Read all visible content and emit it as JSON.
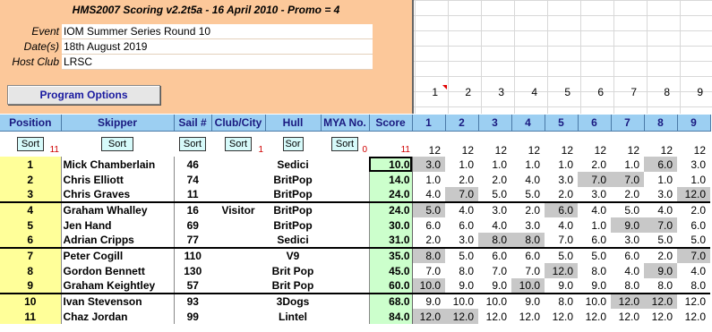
{
  "app_title": "HMS2007 Scoring v2.2t5a - 16 April 2010 - Promo = 4",
  "event_info": [
    {
      "label": "Event",
      "value": "IOM Summer Series Round 10"
    },
    {
      "label": "Date(s)",
      "value": "18th August 2019"
    },
    {
      "label": "Host Club",
      "value": "LRSC"
    }
  ],
  "program_options_label": "Program Options",
  "race_numbers_top": [
    "1",
    "2",
    "3",
    "4",
    "5",
    "6",
    "7",
    "8",
    "9"
  ],
  "columns": {
    "position": "Position",
    "skipper": "Skipper",
    "sail": "Sail #",
    "club": "Club/City",
    "hull": "Hull",
    "mya": "MYA No.",
    "score": "Score",
    "races": [
      "1",
      "2",
      "3",
      "4",
      "5",
      "6",
      "7",
      "8",
      "9"
    ]
  },
  "sort_row": {
    "sort_label": "Sort",
    "sor_label": "Sor",
    "position_count": "11",
    "club_count": "1",
    "mya_count": "0",
    "score_count": "11",
    "race_counts": [
      "12",
      "12",
      "12",
      "12",
      "12",
      "12",
      "12",
      "12",
      "12"
    ]
  },
  "rows": [
    {
      "pos": "1",
      "skipper": "Mick Chamberlain",
      "sail": "46",
      "club": "",
      "hull": "Sedici",
      "mya": "",
      "score": "10.0",
      "races": [
        "3.0",
        "1.0",
        "1.0",
        "1.0",
        "1.0",
        "2.0",
        "1.0",
        "6.0",
        "3.0"
      ],
      "disc": [
        0,
        7
      ]
    },
    {
      "pos": "2",
      "skipper": "Chris Elliott",
      "sail": "74",
      "club": "",
      "hull": "BritPop",
      "mya": "",
      "score": "14.0",
      "races": [
        "1.0",
        "2.0",
        "2.0",
        "4.0",
        "3.0",
        "7.0",
        "7.0",
        "1.0",
        "1.0"
      ],
      "disc": [
        5,
        6
      ]
    },
    {
      "pos": "3",
      "skipper": "Chris Graves",
      "sail": "11",
      "club": "",
      "hull": "BritPop",
      "mya": "",
      "score": "24.0",
      "races": [
        "4.0",
        "7.0",
        "5.0",
        "5.0",
        "2.0",
        "3.0",
        "2.0",
        "3.0",
        "12.0"
      ],
      "disc": [
        1,
        8
      ]
    },
    {
      "pos": "4",
      "skipper": "Graham Whalley",
      "sail": "16",
      "club": "Visitor",
      "hull": "BritPop",
      "mya": "",
      "score": "24.0",
      "races": [
        "5.0",
        "4.0",
        "3.0",
        "2.0",
        "6.0",
        "4.0",
        "5.0",
        "4.0",
        "2.0"
      ],
      "disc": [
        0,
        4
      ]
    },
    {
      "pos": "5",
      "skipper": "Jen Hand",
      "sail": "69",
      "club": "",
      "hull": "BritPop",
      "mya": "",
      "score": "30.0",
      "races": [
        "6.0",
        "6.0",
        "4.0",
        "3.0",
        "4.0",
        "1.0",
        "9.0",
        "7.0",
        "6.0"
      ],
      "disc": [
        6,
        7
      ]
    },
    {
      "pos": "6",
      "skipper": "Adrian Cripps",
      "sail": "77",
      "club": "",
      "hull": "Sedici",
      "mya": "",
      "score": "31.0",
      "races": [
        "2.0",
        "3.0",
        "8.0",
        "8.0",
        "7.0",
        "6.0",
        "3.0",
        "5.0",
        "5.0"
      ],
      "disc": [
        2,
        3
      ]
    },
    {
      "pos": "7",
      "skipper": "Peter Cogill",
      "sail": "110",
      "club": "",
      "hull": "V9",
      "mya": "",
      "score": "35.0",
      "races": [
        "8.0",
        "5.0",
        "6.0",
        "6.0",
        "5.0",
        "5.0",
        "6.0",
        "2.0",
        "7.0"
      ],
      "disc": [
        0,
        8
      ]
    },
    {
      "pos": "8",
      "skipper": "Gordon Bennett",
      "sail": "130",
      "club": "",
      "hull": "Brit Pop",
      "mya": "",
      "score": "45.0",
      "races": [
        "7.0",
        "8.0",
        "7.0",
        "7.0",
        "12.0",
        "8.0",
        "4.0",
        "9.0",
        "4.0"
      ],
      "disc": [
        4,
        7
      ]
    },
    {
      "pos": "9",
      "skipper": "Graham Keightley",
      "sail": "57",
      "club": "",
      "hull": "Brit Pop",
      "mya": "",
      "score": "60.0",
      "races": [
        "10.0",
        "9.0",
        "9.0",
        "10.0",
        "9.0",
        "9.0",
        "8.0",
        "8.0",
        "8.0"
      ],
      "disc": [
        0,
        3
      ]
    },
    {
      "pos": "10",
      "skipper": "Ivan Stevenson",
      "sail": "93",
      "club": "",
      "hull": "3Dogs",
      "mya": "",
      "score": "68.0",
      "races": [
        "9.0",
        "10.0",
        "10.0",
        "9.0",
        "8.0",
        "10.0",
        "12.0",
        "12.0",
        "12.0"
      ],
      "disc": [
        6,
        7
      ]
    },
    {
      "pos": "11",
      "skipper": "Chaz Jordan",
      "sail": "99",
      "club": "",
      "hull": "Lintel",
      "mya": "",
      "score": "84.0",
      "races": [
        "12.0",
        "12.0",
        "12.0",
        "12.0",
        "12.0",
        "12.0",
        "12.0",
        "12.0",
        "12.0"
      ],
      "disc": [
        0,
        1
      ]
    }
  ],
  "colors": {
    "header_panel": "#fcc89a",
    "column_header": "#9ccff2",
    "position_cell": "#ffff99",
    "score_cell": "#ccffcc",
    "discard_cell": "#c8c8c8",
    "sort_button": "#d6fafa",
    "sort_count": "#d00000"
  }
}
